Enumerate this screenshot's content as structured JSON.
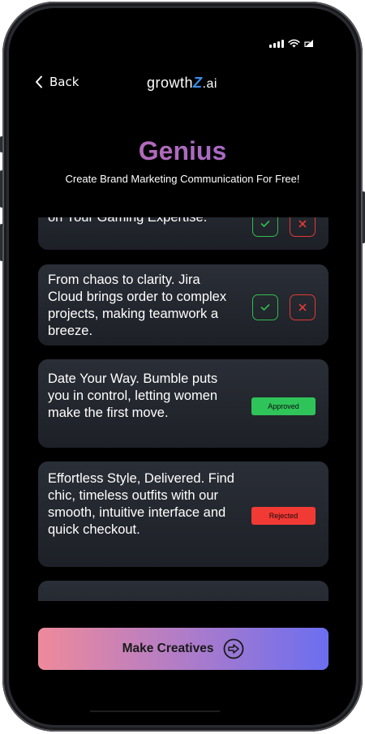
{
  "nav": {
    "back_label": "Back"
  },
  "logo": {
    "part1": "growth",
    "part2": "Z",
    "part3": ".ai"
  },
  "header": {
    "title": "Genius",
    "subtitle": "Create Brand Marketing Communication For Free!"
  },
  "cards": [
    {
      "text": "on Your Gaming Expertise.",
      "state": "pending"
    },
    {
      "text": "From chaos to clarity. Jira Cloud brings order to complex projects, making teamwork a breeze.",
      "state": "pending"
    },
    {
      "text": "Date Your Way. Bumble puts you in control, letting women make the first move.",
      "state": "approved",
      "badge": "Approved"
    },
    {
      "text": "Effortless Style, Delivered. Find chic, timeless outfits with our smooth, intuitive interface and quick checkout.",
      "state": "rejected",
      "badge": "Rejected"
    },
    {
      "text": "",
      "state": "empty"
    }
  ],
  "cta": {
    "label": "Make Creatives"
  },
  "colors": {
    "approve": "#2fbf4e",
    "reject": "#e23b35",
    "logo_accent": "#3a8ee8"
  },
  "icons": {
    "back": "chevron-left-icon",
    "approve": "check-icon",
    "reject": "x-icon",
    "cta": "arrow-right-circle-icon"
  }
}
